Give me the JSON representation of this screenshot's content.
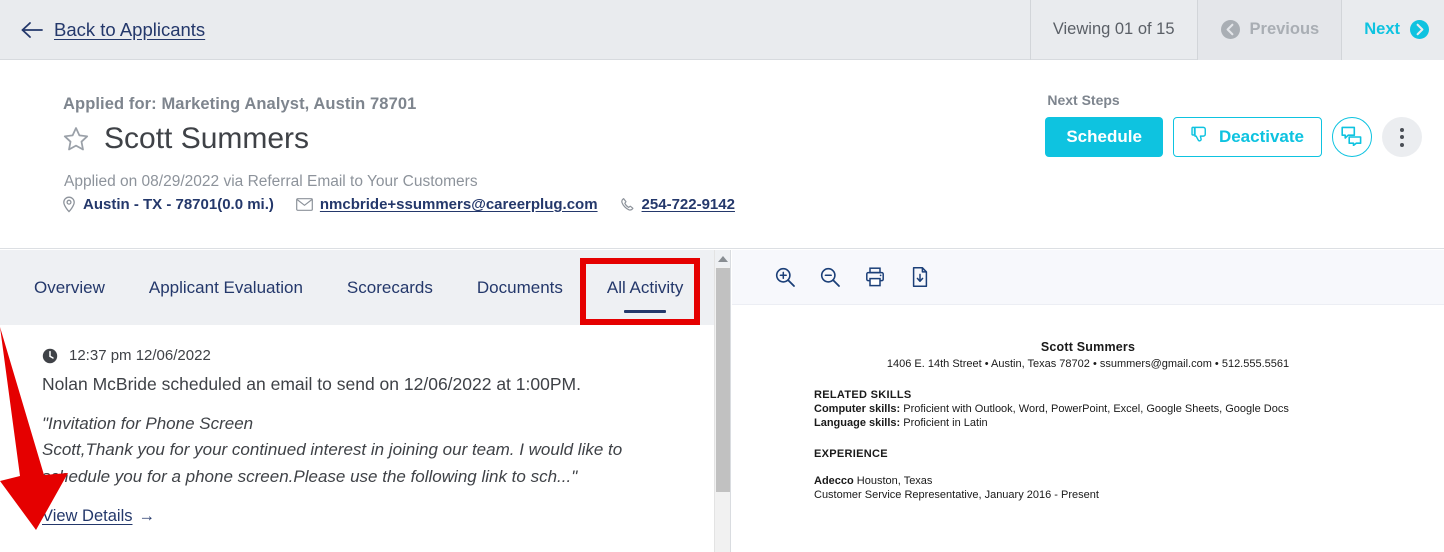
{
  "topbar": {
    "back_label": "Back to Applicants",
    "back_icon": "arrow-left-icon",
    "viewing_text": "Viewing 01 of 15",
    "previous_label": "Previous",
    "next_label": "Next",
    "prev_icon": "circle-chevron-left-icon",
    "next_icon": "circle-chevron-right-icon",
    "prev_color": "#a9aeb4",
    "next_color": "#0ec3e0",
    "background": "#e9ebee"
  },
  "applicant": {
    "applied_for": "Applied for: Marketing Analyst, Austin 78701",
    "name": "Scott Summers",
    "favorite_icon": "star-outline-icon",
    "applied_on": "Applied on 08/29/2022 via Referral Email to Your Customers",
    "location": "Austin - TX - 78701(0.0 mi.)",
    "location_icon": "map-pin-icon",
    "email": "nmcbride+ssummers@careerplug.com",
    "email_icon": "envelope-icon",
    "phone": "254-722-9142",
    "phone_icon": "phone-icon"
  },
  "next_steps": {
    "label": "Next Steps",
    "schedule_label": "Schedule",
    "deactivate_label": "Deactivate",
    "deactivate_icon": "thumbs-down-icon",
    "chat_icon": "chat-bubbles-icon",
    "more_icon": "kebab-menu-icon",
    "accent_color": "#0ec3e0"
  },
  "tabs": [
    {
      "label": "Overview",
      "active": false
    },
    {
      "label": "Applicant Evaluation",
      "active": false
    },
    {
      "label": "Scorecards",
      "active": false
    },
    {
      "label": "Documents",
      "active": false
    },
    {
      "label": "All Activity",
      "active": true
    }
  ],
  "activity": {
    "clock_icon": "clock-icon",
    "timestamp": "12:37 pm 12/06/2022",
    "summary": "Nolan McBride scheduled an email to send on 12/06/2022 at 1:00PM.",
    "quote_line_1": "\"Invitation for Phone Screen",
    "quote_line_2": "Scott,Thank you for your continued interest in joining our team. I would like to",
    "quote_line_3": "schedule you for a phone screen.Please use the following link to sch...\"",
    "view_details_label": "View Details",
    "view_details_arrow": "→"
  },
  "document_viewer": {
    "tools": [
      {
        "name": "zoom-in-icon",
        "label": "Zoom In"
      },
      {
        "name": "zoom-out-icon",
        "label": "Zoom Out"
      },
      {
        "name": "print-icon",
        "label": "Print"
      },
      {
        "name": "download-icon",
        "label": "Download"
      }
    ],
    "resume": {
      "name": "Scott Summers",
      "contact": "1406 E. 14th Street • Austin, Texas 78702 • ssummers@gmail.com • 512.555.5561",
      "skills_heading": "RELATED SKILLS",
      "computer_skills_label": "Computer skills:",
      "computer_skills_value": " Proficient with Outlook, Word, PowerPoint, Excel, Google Sheets, Google Docs",
      "language_skills_label": "Language skills:",
      "language_skills_value": " Proficient in Latin",
      "experience_heading": "EXPERIENCE",
      "employer": "Adecco",
      "employer_location": " Houston, Texas",
      "job_title": "Customer Service Representative, January 2016 - Present"
    }
  },
  "annotations": {
    "highlight_color": "#e50000",
    "box_target": "All Activity",
    "arrow_target": "View Details"
  }
}
